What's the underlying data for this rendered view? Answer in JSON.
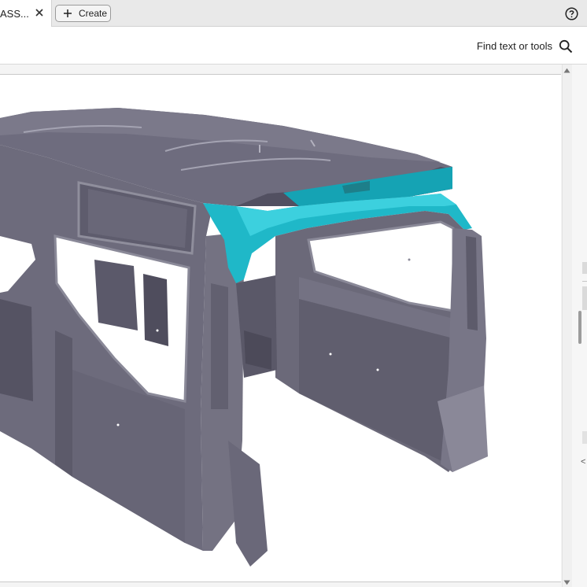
{
  "tabs": [
    {
      "label": "ASS...",
      "active": true
    }
  ],
  "create_button": {
    "label": "Create"
  },
  "toolbar": {
    "find_label": "Find text or tools"
  },
  "rail": {
    "arrow": "<"
  },
  "icons": {
    "close": "close-icon",
    "plus": "plus-icon",
    "help": "help-icon",
    "search": "search-icon",
    "scroll_up": "chevron-up-icon",
    "scroll_down": "chevron-down-icon"
  },
  "colors": {
    "body_metal": "#6d6b7c",
    "highlight_part": "#1fb8c8",
    "tab_bar": "#e9e9e9"
  }
}
